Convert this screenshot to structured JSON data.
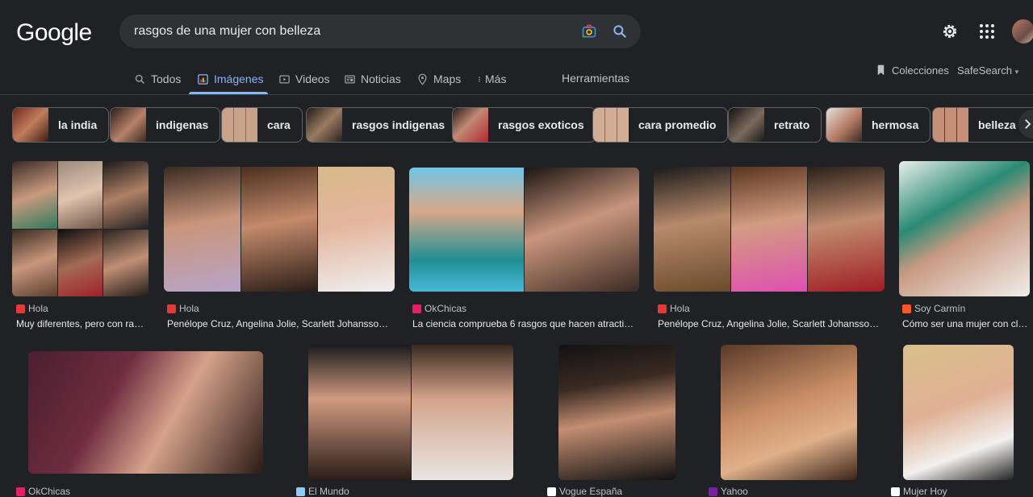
{
  "logo": "Google",
  "search": {
    "query": "rasgos de una mujer con belleza"
  },
  "nav": {
    "tabs": [
      {
        "label": "Todos"
      },
      {
        "label": "Imágenes"
      },
      {
        "label": "Videos"
      },
      {
        "label": "Noticias"
      },
      {
        "label": "Maps"
      },
      {
        "label": "Más"
      }
    ],
    "tools": "Herramientas",
    "collections": "Colecciones",
    "safesearch": "SafeSearch"
  },
  "chips": [
    {
      "label": "la india"
    },
    {
      "label": "indigenas"
    },
    {
      "label": "cara"
    },
    {
      "label": "rasgos indigenas"
    },
    {
      "label": "rasgos exoticos"
    },
    {
      "label": "cara promedio"
    },
    {
      "label": "retrato"
    },
    {
      "label": "hermosa"
    },
    {
      "label": "belleza f"
    }
  ],
  "results": [
    {
      "source": "Hola",
      "caption": "Muy diferentes, pero con rasg...",
      "fav_color": "#e53935"
    },
    {
      "source": "Hola",
      "caption": "Penélope Cruz, Angelina Jolie, Scarlett Johansson.....",
      "fav_color": "#e53935"
    },
    {
      "source": "OkChicas",
      "caption": "La ciencia comprueba 6 rasgos que hacen atractiva ...",
      "fav_color": "#e91e63"
    },
    {
      "source": "Hola",
      "caption": "Penélope Cruz, Angelina Jolie, Scarlett Johansson.....",
      "fav_color": "#e53935"
    },
    {
      "source": "Soy Carmín",
      "caption": "Cómo ser una mujer con cla...",
      "fav_color": "#ff5722"
    },
    {
      "source": "OkChicas",
      "caption": "",
      "fav_color": "#e91e63"
    },
    {
      "source": "El Mundo",
      "caption": "",
      "fav_color": "#90caf9"
    },
    {
      "source": "Vogue España",
      "caption": "",
      "fav_color": "#ffffff"
    },
    {
      "source": "Yahoo",
      "caption": "",
      "fav_color": "#7b1fa2"
    },
    {
      "source": "Mujer Hoy",
      "caption": "",
      "fav_color": "#ffffff"
    }
  ]
}
